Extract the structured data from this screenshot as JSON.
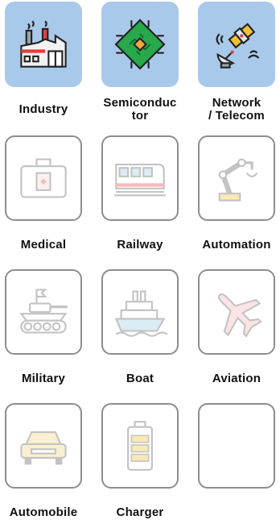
{
  "rows": [
    [
      {
        "label": "Industry",
        "icon": "factory-icon",
        "state": "active"
      },
      {
        "label": "Semiconduc tor",
        "label_lines": [
          "Semiconduc",
          "tor"
        ],
        "icon": "chip-icon",
        "state": "active"
      },
      {
        "label": "Network / Telecom",
        "label_lines": [
          "Network",
          "/ Telecom"
        ],
        "icon": "satellite-icon",
        "state": "active"
      }
    ],
    [
      {
        "label": "Medical",
        "icon": "medical-kit-icon",
        "state": "inactive"
      },
      {
        "label": "Railway",
        "icon": "train-icon",
        "state": "inactive"
      },
      {
        "label": "Automation",
        "icon": "robot-arm-icon",
        "state": "inactive"
      }
    ],
    [
      {
        "label": "Military",
        "icon": "tank-icon",
        "state": "inactive"
      },
      {
        "label": "Boat",
        "icon": "ship-icon",
        "state": "inactive"
      },
      {
        "label": "Aviation",
        "icon": "airplane-icon",
        "state": "inactive"
      }
    ],
    [
      {
        "label": "Automobile",
        "icon": "car-icon",
        "state": "inactive"
      },
      {
        "label": "Charger",
        "icon": "battery-icon",
        "state": "inactive"
      },
      {
        "label": "",
        "icon": "",
        "state": "empty"
      }
    ]
  ],
  "colors": {
    "active_tile": "#a9c9ea",
    "tile_border": "#8d8d8d",
    "label_text": "#111111"
  }
}
